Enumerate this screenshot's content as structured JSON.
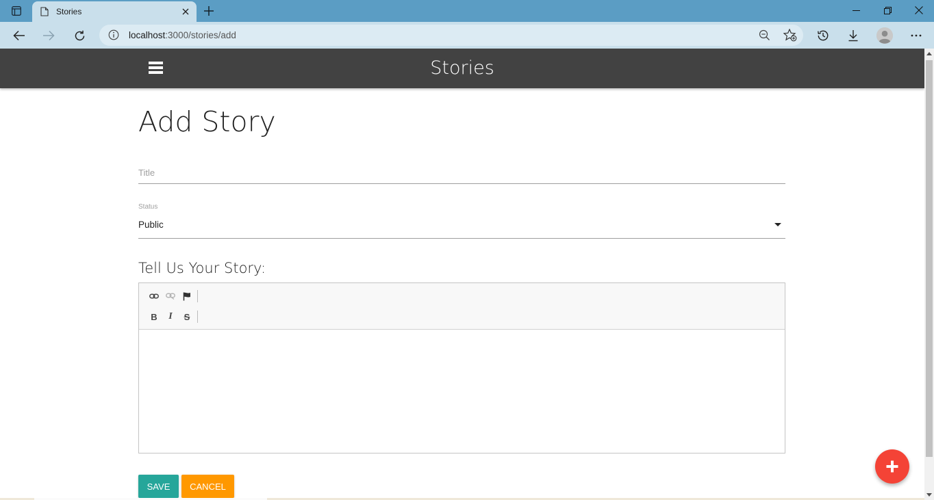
{
  "browser": {
    "tab_title": "Stories",
    "url_host": "localhost",
    "url_path": ":3000/stories/add"
  },
  "app": {
    "brand": "Stories"
  },
  "form": {
    "heading": "Add Story",
    "title_placeholder": "Title",
    "status_label": "Status",
    "status_value": "Public",
    "story_label": "Tell Us Your Story:",
    "save_label": "SAVE",
    "cancel_label": "CANCEL"
  },
  "editor_toolbar": {
    "bold": "B",
    "italic": "I",
    "strike": "S"
  },
  "colors": {
    "tab_bar": "#5b9dc4",
    "app_nav": "#424242",
    "save": "#26a69a",
    "cancel": "#ff9800",
    "fab": "#f44336"
  },
  "icons": [
    "sidebar-icon",
    "page-icon",
    "close-icon",
    "plus-icon",
    "minimize-icon",
    "restore-icon",
    "back-icon",
    "forward-icon",
    "refresh-icon",
    "info-icon",
    "zoom-out-icon",
    "add-favorite-icon",
    "history-icon",
    "download-icon",
    "profile-icon",
    "more-icon",
    "menu-icon",
    "link-icon",
    "unlink-icon",
    "flag-icon",
    "add-icon"
  ]
}
